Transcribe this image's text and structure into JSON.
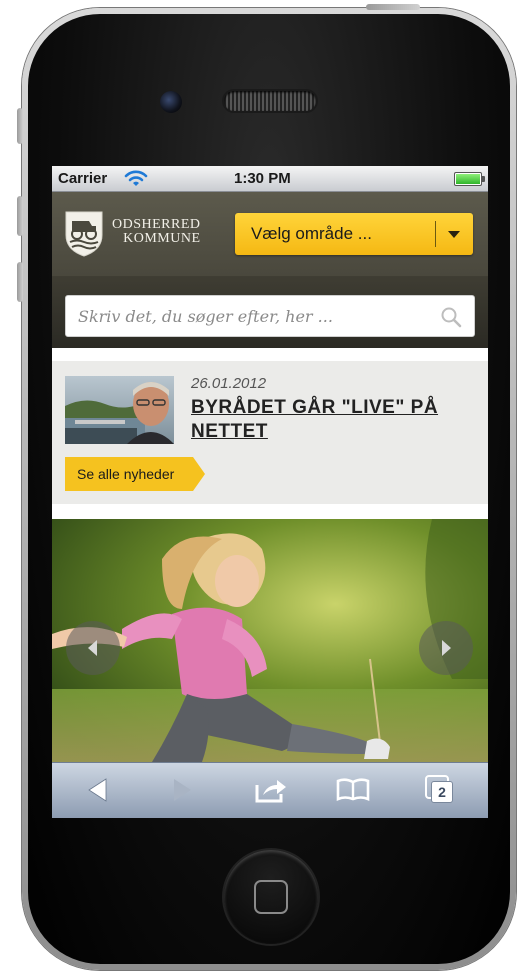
{
  "status_bar": {
    "carrier": "Carrier",
    "time": "1:30 PM",
    "battery_level": 1.0,
    "icons": [
      "wifi-icon",
      "battery-icon"
    ]
  },
  "header": {
    "logo_line1": "ODSHERRED",
    "logo_line2": "KOMMUNE",
    "area_select_label": "Vælg område ..."
  },
  "search": {
    "placeholder": "Skriv det, du søger efter, her ..."
  },
  "news": {
    "date": "26.01.2012",
    "title": "BYRÅDET GÅR \"LIVE\" PÅ NETTET",
    "all_news_label": "Se alle nyheder"
  },
  "browser_toolbar": {
    "icons": [
      "back-icon",
      "forward-icon",
      "share-icon",
      "bookmarks-icon",
      "tabs-icon"
    ],
    "tab_count": "2"
  },
  "colors": {
    "accent_yellow": "#f5b813",
    "header_bg": "#4e4c40",
    "search_bar_bg": "#2b2a24",
    "news_bg": "#ebebe9"
  }
}
